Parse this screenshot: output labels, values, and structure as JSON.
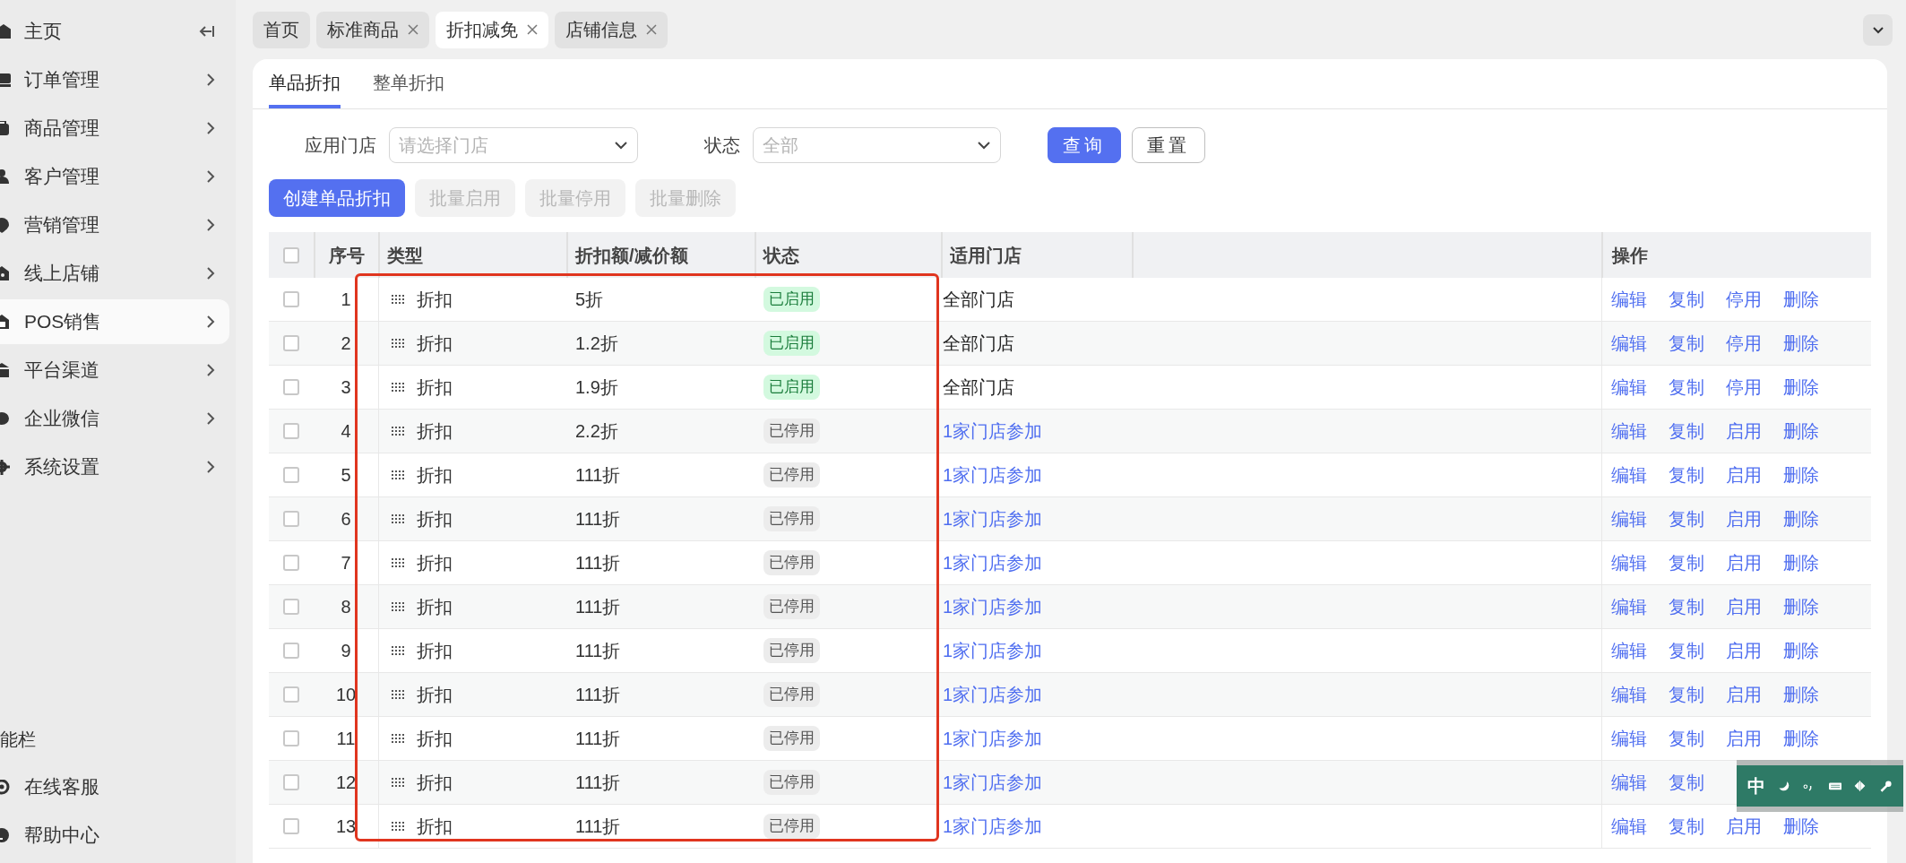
{
  "sidebar": {
    "items": [
      {
        "label": "主页",
        "selected": false,
        "kind": "home"
      },
      {
        "label": "订单管理",
        "selected": false,
        "kind": "menu"
      },
      {
        "label": "商品管理",
        "selected": false,
        "kind": "menu"
      },
      {
        "label": "客户管理",
        "selected": false,
        "kind": "menu"
      },
      {
        "label": "营销管理",
        "selected": false,
        "kind": "menu"
      },
      {
        "label": "线上店铺",
        "selected": false,
        "kind": "menu"
      },
      {
        "label": "POS销售",
        "selected": true,
        "kind": "menu"
      },
      {
        "label": "平台渠道",
        "selected": false,
        "kind": "menu"
      },
      {
        "label": "企业微信",
        "selected": false,
        "kind": "menu"
      },
      {
        "label": "系统设置",
        "selected": false,
        "kind": "menu"
      }
    ],
    "footer_title": "能栏",
    "footer_items": [
      "在线客服",
      "帮助中心"
    ]
  },
  "page_tabs": [
    {
      "label": "首页",
      "selected": false,
      "closable": false
    },
    {
      "label": "标准商品",
      "selected": false,
      "closable": true
    },
    {
      "label": "折扣减免",
      "selected": true,
      "closable": true
    },
    {
      "label": "店铺信息",
      "selected": false,
      "closable": true
    }
  ],
  "sub_tabs": [
    {
      "label": "单品折扣",
      "selected": true
    },
    {
      "label": "整单折扣",
      "selected": false
    }
  ],
  "filters": [
    {
      "label": "应用门店",
      "placeholder": "请选择门店"
    },
    {
      "label": "状态",
      "placeholder": "全部"
    }
  ],
  "filter_buttons": [
    {
      "label": "查询",
      "kind": "primary"
    },
    {
      "label": "重置",
      "kind": "outline"
    }
  ],
  "actions": [
    {
      "label": "创建单品折扣",
      "disabled": false
    },
    {
      "label": "批量启用",
      "disabled": true
    },
    {
      "label": "批量停用",
      "disabled": true
    },
    {
      "label": "批量删除",
      "disabled": true
    }
  ],
  "table": {
    "all_checked": false,
    "columns": [
      "序号",
      "类型",
      "折扣额/减价额",
      "状态",
      "适用门店",
      "操作"
    ],
    "rows": [
      {
        "checked": false,
        "no": "1",
        "type": "折扣",
        "amount": "5折",
        "status": "已启用",
        "enabled": true,
        "store": "全部门店",
        "store_link": false,
        "ops": [
          "编辑",
          "复制",
          "停用",
          "删除"
        ]
      },
      {
        "checked": false,
        "no": "2",
        "type": "折扣",
        "amount": "1.2折",
        "status": "已启用",
        "enabled": true,
        "store": "全部门店",
        "store_link": false,
        "ops": [
          "编辑",
          "复制",
          "停用",
          "删除"
        ]
      },
      {
        "checked": false,
        "no": "3",
        "type": "折扣",
        "amount": "1.9折",
        "status": "已启用",
        "enabled": true,
        "store": "全部门店",
        "store_link": false,
        "ops": [
          "编辑",
          "复制",
          "停用",
          "删除"
        ]
      },
      {
        "checked": false,
        "no": "4",
        "type": "折扣",
        "amount": "2.2折",
        "status": "已停用",
        "enabled": false,
        "store": "1家门店参加",
        "store_link": true,
        "ops": [
          "编辑",
          "复制",
          "启用",
          "删除"
        ]
      },
      {
        "checked": false,
        "no": "5",
        "type": "折扣",
        "amount": "111折",
        "status": "已停用",
        "enabled": false,
        "store": "1家门店参加",
        "store_link": true,
        "ops": [
          "编辑",
          "复制",
          "启用",
          "删除"
        ]
      },
      {
        "checked": false,
        "no": "6",
        "type": "折扣",
        "amount": "111折",
        "status": "已停用",
        "enabled": false,
        "store": "1家门店参加",
        "store_link": true,
        "ops": [
          "编辑",
          "复制",
          "启用",
          "删除"
        ]
      },
      {
        "checked": false,
        "no": "7",
        "type": "折扣",
        "amount": "111折",
        "status": "已停用",
        "enabled": false,
        "store": "1家门店参加",
        "store_link": true,
        "ops": [
          "编辑",
          "复制",
          "启用",
          "删除"
        ]
      },
      {
        "checked": false,
        "no": "8",
        "type": "折扣",
        "amount": "111折",
        "status": "已停用",
        "enabled": false,
        "store": "1家门店参加",
        "store_link": true,
        "ops": [
          "编辑",
          "复制",
          "启用",
          "删除"
        ]
      },
      {
        "checked": false,
        "no": "9",
        "type": "折扣",
        "amount": "111折",
        "status": "已停用",
        "enabled": false,
        "store": "1家门店参加",
        "store_link": true,
        "ops": [
          "编辑",
          "复制",
          "启用",
          "删除"
        ]
      },
      {
        "checked": false,
        "no": "10",
        "type": "折扣",
        "amount": "111折",
        "status": "已停用",
        "enabled": false,
        "store": "1家门店参加",
        "store_link": true,
        "ops": [
          "编辑",
          "复制",
          "启用",
          "删除"
        ]
      },
      {
        "checked": false,
        "no": "11",
        "type": "折扣",
        "amount": "111折",
        "status": "已停用",
        "enabled": false,
        "store": "1家门店参加",
        "store_link": true,
        "ops": [
          "编辑",
          "复制",
          "启用",
          "删除"
        ]
      },
      {
        "checked": false,
        "no": "12",
        "type": "折扣",
        "amount": "111折",
        "status": "已停用",
        "enabled": false,
        "store": "1家门店参加",
        "store_link": true,
        "ops": [
          "编辑",
          "复制"
        ]
      },
      {
        "checked": false,
        "no": "13",
        "type": "折扣",
        "amount": "111折",
        "status": "已停用",
        "enabled": false,
        "store": "1家门店参加",
        "store_link": true,
        "ops": [
          "编辑",
          "复制",
          "启用",
          "删除"
        ]
      }
    ]
  },
  "ime_bar": {
    "mode": "中"
  }
}
